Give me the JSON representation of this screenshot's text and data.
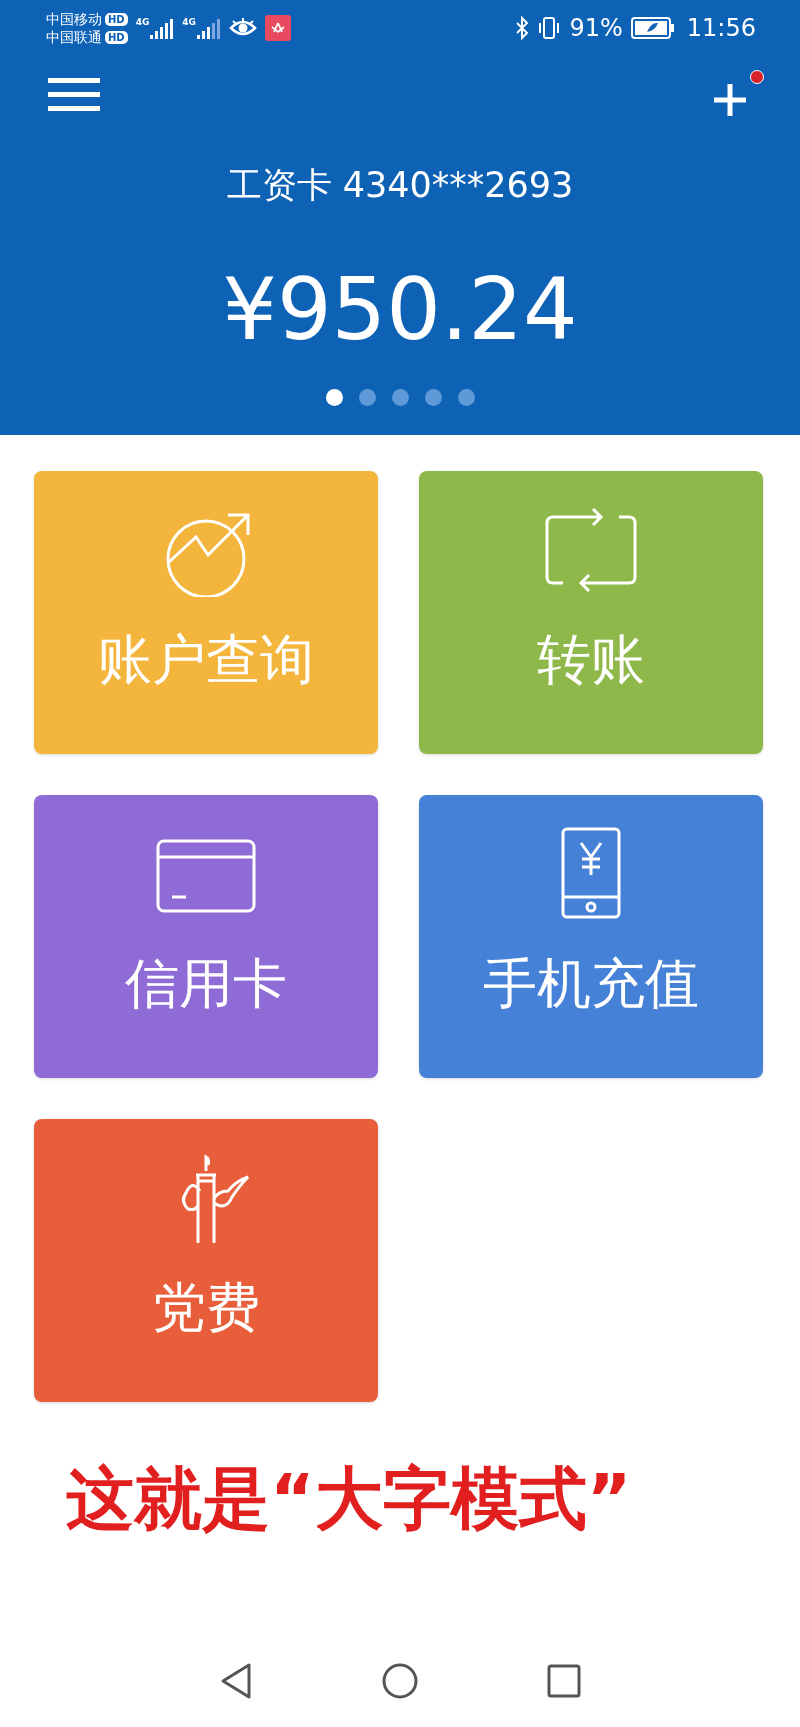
{
  "status_bar": {
    "carriers": [
      {
        "name": "中国移动",
        "badge": "HD"
      },
      {
        "name": "中国联通",
        "badge": "HD"
      }
    ],
    "network_labels": [
      "4G",
      "4G"
    ],
    "battery_percent": "91%",
    "time": "11:56"
  },
  "header": {
    "notification_dot": true,
    "card_label": "工资卡 4340***2693",
    "balance": "¥950.24",
    "pages": [
      {
        "selected": true
      },
      {
        "selected": false
      },
      {
        "selected": false
      },
      {
        "selected": false
      },
      {
        "selected": false
      }
    ]
  },
  "tiles": [
    {
      "label": "账户查询",
      "kind": "chart",
      "color": "#f3b53c"
    },
    {
      "label": "转账",
      "kind": "transfer",
      "color": "#8fb84a"
    },
    {
      "label": "信用卡",
      "kind": "card",
      "color": "#8f6bd6"
    },
    {
      "label": "手机充值",
      "kind": "phone",
      "color": "#4581d6"
    },
    {
      "label": "党费",
      "kind": "monument",
      "color": "#e85e3a"
    }
  ],
  "caption": "这就是“大字模式”"
}
